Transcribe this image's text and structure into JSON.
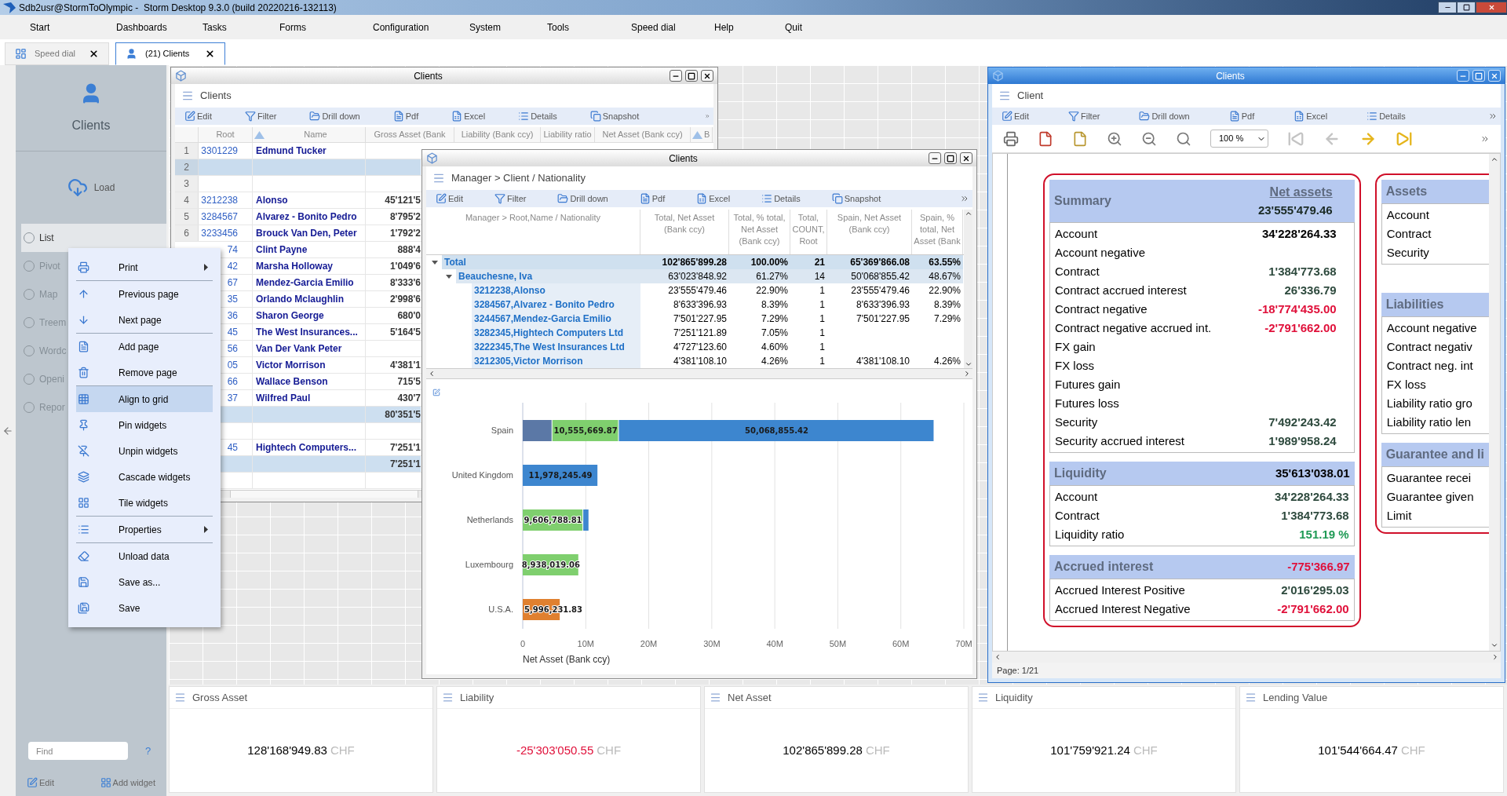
{
  "window": {
    "title": "Sdb2usr@StormToOlympic -  Storm Desktop 9.3.0 (build 20220216-132113)"
  },
  "menu_bar": [
    "Start",
    "Dashboards",
    "Tasks",
    "Forms",
    "Configuration",
    "System",
    "Tools",
    "Speed dial",
    "Help",
    "Quit"
  ],
  "tabs": [
    {
      "label": "Speed dial",
      "selected": false
    },
    {
      "label": "(21) Clients",
      "selected": true
    }
  ],
  "sidebar": {
    "title": "Clients",
    "load_button": "Load",
    "views": [
      {
        "label": "List",
        "selected": true
      },
      {
        "label": "Pivot",
        "selected": false
      },
      {
        "label": "Map",
        "selected": false
      },
      {
        "label": "Treem",
        "selected": false
      },
      {
        "label": "Wordc",
        "selected": false
      },
      {
        "label": "Openi",
        "selected": false
      },
      {
        "label": "Repor",
        "selected": false
      }
    ],
    "find": {
      "placeholder": "Find"
    },
    "help": "?",
    "edit_button": "Edit",
    "add_widget_button": "Add widget"
  },
  "context_menu": {
    "groups": [
      [
        {
          "label": "Print",
          "submenu": true,
          "highlighted": false
        }
      ],
      [
        {
          "label": "Previous page",
          "submenu": false,
          "highlighted": false
        },
        {
          "label": "Next page",
          "submenu": false,
          "highlighted": false
        }
      ],
      [
        {
          "label": "Add page",
          "submenu": false,
          "highlighted": false
        },
        {
          "label": "Remove page",
          "submenu": false,
          "highlighted": false
        }
      ],
      [
        {
          "label": "Align to grid",
          "submenu": false,
          "highlighted": true
        },
        {
          "label": "Pin widgets",
          "submenu": false,
          "highlighted": false
        },
        {
          "label": "Unpin widgets",
          "submenu": false,
          "highlighted": false
        },
        {
          "label": "Cascade widgets",
          "submenu": false,
          "highlighted": false
        },
        {
          "label": "Tile widgets",
          "submenu": false,
          "highlighted": false
        }
      ],
      [
        {
          "label": "Properties",
          "submenu": true,
          "highlighted": false
        }
      ],
      [
        {
          "label": "Unload data",
          "submenu": false,
          "highlighted": false
        },
        {
          "label": "Save as...",
          "submenu": false,
          "highlighted": false
        },
        {
          "label": "Save",
          "submenu": false,
          "highlighted": false
        }
      ]
    ]
  },
  "clients_list": {
    "window_title": "Clients",
    "active": false,
    "title": "Clients",
    "toolbar": [
      "Edit",
      "Filter",
      "Drill down",
      "Pdf",
      "Excel",
      "Details",
      "Snapshot"
    ],
    "columns": [
      {
        "label": "Root",
        "sorted": false
      },
      {
        "label": "Name",
        "sorted": true
      },
      {
        "label": "Gross Asset (Bank",
        "sorted": false
      },
      {
        "label": "Liability (Bank ccy)",
        "sorted": false
      },
      {
        "label": "Liability ratio",
        "sorted": false
      },
      {
        "label": "Net Asset (Bank ccy)",
        "sorted": false
      },
      {
        "label": "B",
        "sorted": true
      }
    ],
    "rows": [
      {
        "kind": "data",
        "number": "1",
        "root": "3301229",
        "name": "Edmund Tucker",
        "selected": false
      },
      {
        "kind": "data",
        "number": "2",
        "selected": true
      },
      {
        "kind": "data",
        "number": "3",
        "selected": false
      },
      {
        "kind": "data",
        "number": "4",
        "root": "3212238",
        "name": "Alonso",
        "gross": "45'121'5",
        "selected": false
      },
      {
        "kind": "data",
        "number": "5",
        "root": "3284567",
        "name": "Alvarez - Bonito Pedro",
        "gross": "8'795'2",
        "selected": false
      },
      {
        "kind": "data",
        "number": "6",
        "root": "3233456",
        "name": "Brouck Van Den, Peter",
        "gross": "1'792'2",
        "selected": false
      },
      {
        "kind": "data",
        "root": "74",
        "name": "Clint Payne",
        "gross": "888'4",
        "selected": false
      },
      {
        "kind": "data",
        "root": "42",
        "name": "Marsha Holloway",
        "gross": "1'049'6",
        "selected": false
      },
      {
        "kind": "data",
        "root": "67",
        "name": "Mendez-Garcia Emilio",
        "gross": "8'333'6",
        "selected": false
      },
      {
        "kind": "data",
        "root": "35",
        "name": "Orlando Mclaughlin",
        "gross": "2'998'6",
        "selected": false
      },
      {
        "kind": "data",
        "root": "36",
        "name": "Sharon George",
        "gross": "680'0",
        "selected": false
      },
      {
        "kind": "data",
        "root": "45",
        "name": "The West Insurances...",
        "gross": "5'164'5",
        "selected": false
      },
      {
        "kind": "data",
        "root": "56",
        "name": "Van Der Vank Peter",
        "selected": false
      },
      {
        "kind": "data",
        "root": "05",
        "name": "Victor Morrison",
        "gross": "4'381'1",
        "selected": false
      },
      {
        "kind": "data",
        "root": "66",
        "name": "Wallace Benson",
        "gross": "715'5",
        "selected": false
      },
      {
        "kind": "data",
        "root": "37",
        "name": "Wilfred Paul",
        "gross": "430'7",
        "selected": false
      },
      {
        "kind": "subtotal",
        "gross": "80'351'5"
      },
      {
        "kind": "data"
      },
      {
        "kind": "data",
        "root": "45",
        "name": "Hightech Computers...",
        "gross": "7'251'1",
        "selected": false
      },
      {
        "kind": "subtotal",
        "gross": "7'251'1"
      },
      {
        "kind": "data"
      }
    ]
  },
  "pivot": {
    "window_title": "Clients",
    "active": false,
    "title": "Manager > Client / Nationality",
    "toolbar": [
      "Edit",
      "Filter",
      "Drill down",
      "Pdf",
      "Excel",
      "Details",
      "Snapshot"
    ],
    "columns": [
      "Manager > Root,Name / Nationality",
      "Total, Net Asset (Bank ccy)",
      "Total, % total, Net Asset (Bank ccy)",
      "Total, COUNT, Root",
      "Spain, Net Asset (Bank ccy)",
      "Spain, % total, Net Asset (Bank"
    ],
    "rows": [
      {
        "label": "Total",
        "expanded": true,
        "values": [
          "102'865'899.28",
          "100.00%",
          "21",
          "65'369'866.08",
          "63.55%"
        ],
        "children": [
          {
            "label": "Beauchesne, Iva",
            "expanded": true,
            "values": [
              "63'023'848.92",
              "61.27%",
              "14",
              "50'068'855.42",
              "48.67%"
            ],
            "children": [
              {
                "label": "3212238,Alonso",
                "values": [
                  "23'555'479.46",
                  "22.90%",
                  "1",
                  "23'555'479.46",
                  "22.90%"
                ]
              },
              {
                "label": "3284567,Alvarez - Bonito Pedro",
                "values": [
                  "8'633'396.93",
                  "8.39%",
                  "1",
                  "8'633'396.93",
                  "8.39%"
                ]
              },
              {
                "label": "3244567,Mendez-Garcia Emilio",
                "values": [
                  "7'501'227.95",
                  "7.29%",
                  "1",
                  "7'501'227.95",
                  "7.29%"
                ]
              },
              {
                "label": "3282345,Hightech Computers Ltd",
                "values": [
                  "7'251'121.89",
                  "7.05%",
                  "1"
                ]
              },
              {
                "label": "3222345,The West Insurances Ltd",
                "values": [
                  "4'727'123.60",
                  "4.60%",
                  "1"
                ]
              },
              {
                "label": "3212305,Victor Morrison",
                "values": [
                  "4'381'108.10",
                  "4.26%",
                  "1",
                  "4'381'108.10",
                  "4.26%"
                ]
              }
            ]
          }
        ]
      }
    ],
    "chart_data": {
      "type": "bar",
      "orientation": "horizontal",
      "stacked": true,
      "grid": true,
      "xlabel": "Net Asset (Bank ccy)",
      "categories": [
        "Spain",
        "United Kingdom",
        "Netherlands",
        "Luxembourg",
        "U.S.A."
      ],
      "series": [
        {
          "color": "#5b78a6",
          "values": [
            4700000,
            null,
            null,
            null,
            null
          ]
        },
        {
          "color": "#7fcf6e",
          "values": [
            10555669.87,
            null,
            9606788.81,
            8938019.06,
            null
          ]
        },
        {
          "color": "#3d86cf",
          "values": [
            50068855.42,
            11978245.49,
            950000,
            null,
            null
          ]
        },
        {
          "color": "#e0802f",
          "values": [
            null,
            null,
            null,
            null,
            5996231.83
          ]
        }
      ],
      "xlim": [
        0,
        70000000
      ],
      "xticks": [
        {
          "value": 0,
          "label": "0"
        },
        {
          "value": 10000000,
          "label": "10M"
        },
        {
          "value": 20000000,
          "label": "20M"
        },
        {
          "value": 30000000,
          "label": "30M"
        },
        {
          "value": 40000000,
          "label": "40M"
        },
        {
          "value": 50000000,
          "label": "50M"
        },
        {
          "value": 60000000,
          "label": "60M"
        },
        {
          "value": 70000000,
          "label": "70M"
        }
      ],
      "value_labels": [
        [
          null,
          null,
          null,
          null,
          null
        ],
        [
          "10,555,669.87",
          null,
          "9,606,788.81",
          "8,938,019.06",
          null
        ],
        [
          "50,068,855.42",
          "11,978,245.49",
          null,
          null,
          null
        ],
        [
          null,
          null,
          null,
          null,
          "5,996,231.83"
        ]
      ]
    }
  },
  "client_report": {
    "window_title": "Clients",
    "active": true,
    "title": "Client",
    "toolbar": [
      "Edit",
      "Filter",
      "Drill down",
      "Pdf",
      "Excel",
      "Details"
    ],
    "zoom": "100 %",
    "pager_buttons": [
      {
        "disabled": true
      },
      {
        "disabled": true
      },
      {
        "disabled": false
      },
      {
        "disabled": false
      }
    ],
    "summary_card": [
      {
        "title": "Summary",
        "subtitle": "Net assets",
        "total": {
          "value": "23'555'479.46",
          "color": "#1a2a24"
        },
        "rows": [
          {
            "label": "Account",
            "value": "34'228'264.33",
            "color": "#000000"
          },
          {
            "label": "Account negative"
          },
          {
            "label": "Contract",
            "value": "1'384'773.68",
            "color": "#2e4a3e"
          },
          {
            "label": "Contract accrued interest",
            "value": "26'336.79",
            "color": "#2e4a3e"
          },
          {
            "label": "Contract negative",
            "value": "-18'774'435.00",
            "color": "#e0103a"
          },
          {
            "label": "Contract negative accrued int.",
            "value": "-2'791'662.00",
            "color": "#e0103a"
          },
          {
            "label": "FX gain"
          },
          {
            "label": "FX loss"
          },
          {
            "label": "Futures gain"
          },
          {
            "label": "Futures loss"
          },
          {
            "label": "Security",
            "value": "7'492'243.42",
            "color": "#2e4a3e"
          },
          {
            "label": "Security accrued interest",
            "value": "1'989'958.24",
            "color": "#2e4a3e"
          }
        ]
      },
      {
        "title": "Liquidity",
        "total": {
          "value": "35'613'038.01",
          "color": "#000000"
        },
        "rows": [
          {
            "label": "Account",
            "value": "34'228'264.33",
            "color": "#2e4a3e"
          },
          {
            "label": "Contract",
            "value": "1'384'773.68",
            "color": "#2e4a3e"
          },
          {
            "label": "Liquidity ratio",
            "value": "151.19 %",
            "color": "#1f9a55"
          }
        ]
      },
      {
        "title": "Accrued interest",
        "total": {
          "value": "-775'366.97",
          "color": "#e0103a"
        },
        "rows": [
          {
            "label": "Accrued Interest Positive",
            "value": "2'016'295.03",
            "color": "#2e4a3e"
          },
          {
            "label": "Accrued Interest Negative",
            "value": "-2'791'662.00",
            "color": "#e0103a"
          }
        ]
      }
    ],
    "side_card": [
      {
        "title": "Assets",
        "rows": [
          {
            "label": "Account"
          },
          {
            "label": "Contract"
          },
          {
            "label": "Security"
          }
        ]
      },
      {
        "title": "Liabilities",
        "rows": [
          {
            "label": "Account negative"
          },
          {
            "label": "Contract negativ"
          },
          {
            "label": "Contract neg. int"
          },
          {
            "label": "FX loss"
          },
          {
            "label": "Liability ratio gro"
          },
          {
            "label": "Liability ratio len"
          }
        ]
      },
      {
        "title": "Guarantee and li",
        "rows": [
          {
            "label": "Guarantee recei"
          },
          {
            "label": "Guarantee given"
          },
          {
            "label": "Limit"
          }
        ]
      }
    ],
    "status": "Page: 1/21"
  },
  "kpi_cards": [
    {
      "title": "Gross Asset",
      "value": "128'168'949.83",
      "unit": "CHF",
      "negative": false
    },
    {
      "title": "Liability",
      "value": "-25'303'050.55",
      "unit": "CHF",
      "negative": true
    },
    {
      "title": "Net Asset",
      "value": "102'865'899.28",
      "unit": "CHF",
      "negative": false
    },
    {
      "title": "Liquidity",
      "value": "101'759'921.24",
      "unit": "CHF",
      "negative": false
    },
    {
      "title": "Lending Value",
      "value": "101'544'664.47",
      "unit": "CHF",
      "negative": false
    }
  ]
}
